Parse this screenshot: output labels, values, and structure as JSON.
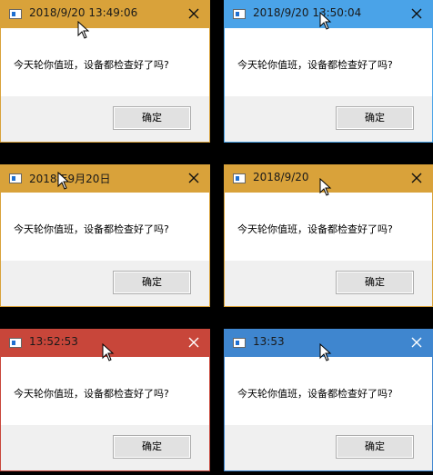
{
  "dialogs": [
    {
      "title": "2018/9/20 13:49:06",
      "message": "今天轮你值班，设备都检查好了吗?",
      "ok_label": "确定",
      "titlebar_color": "#d9a23a",
      "border_color": "#d9a23a"
    },
    {
      "title": "2018/9/20 13:50:04",
      "message": "今天轮你值班，设备都检查好了吗?",
      "ok_label": "确定",
      "titlebar_color": "#4aa3e8",
      "border_color": "#4aa3e8"
    },
    {
      "title": "2018年9月20日",
      "message": "今天轮你值班，设备都检查好了吗?",
      "ok_label": "确定",
      "titlebar_color": "#d9a23a",
      "border_color": "#d9a23a"
    },
    {
      "title": "2018/9/20",
      "message": "今天轮你值班，设备都检查好了吗?",
      "ok_label": "确定",
      "titlebar_color": "#d9a23a",
      "border_color": "#d9a23a"
    },
    {
      "title": "13:52:53",
      "message": "今天轮你值班，设备都检查好了吗?",
      "ok_label": "确定",
      "titlebar_color": "#c8463a",
      "border_color": "#c8463a"
    },
    {
      "title": "13:53",
      "message": "今天轮你值班，设备都检查好了吗?",
      "ok_label": "确定",
      "titlebar_color": "#3f86cf",
      "border_color": "#3f86cf"
    }
  ],
  "icons": {
    "app": "app-window-icon",
    "close": "close-icon",
    "cursor": "mouse-cursor-icon"
  }
}
